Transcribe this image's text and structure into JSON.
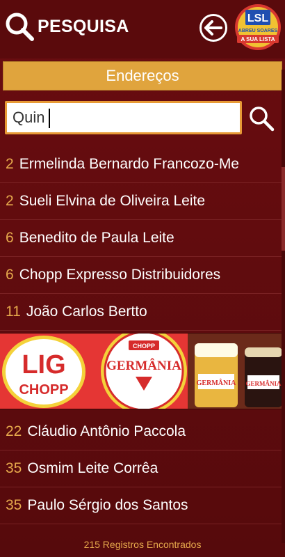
{
  "header": {
    "title": "PESQUISA",
    "logo_line1": "ABREU SOARES",
    "logo_line2": "A SUA LISTA"
  },
  "section": {
    "title": "Endereços"
  },
  "search": {
    "value": "Quin"
  },
  "results": [
    {
      "num": "2",
      "name": "Ermelinda Bernardo Francozo-Me"
    },
    {
      "num": "2",
      "name": "Sueli Elvina de Oliveira Leite"
    },
    {
      "num": "6",
      "name": "Benedito de Paula Leite"
    },
    {
      "num": "6",
      "name": "Chopp Expresso Distribuidores"
    },
    {
      "num": "11",
      "name": "João Carlos Bertto"
    }
  ],
  "banner": {
    "brand1": "LIG",
    "brand2": "CHOPP",
    "brand3": "CHOPP",
    "brand4": "GERMÂNIA"
  },
  "results_more": [
    {
      "num": "22",
      "name": "Cláudio Antônio Paccola"
    },
    {
      "num": "35",
      "name": "Osmim Leite Corrêa"
    },
    {
      "num": "35",
      "name": "Paulo Sérgio dos Santos"
    }
  ],
  "footer": {
    "text": "215  Registros Encontrados"
  },
  "colors": {
    "background": "#5e0b0d",
    "accent": "#e0a43d",
    "number": "#e6a94c"
  }
}
